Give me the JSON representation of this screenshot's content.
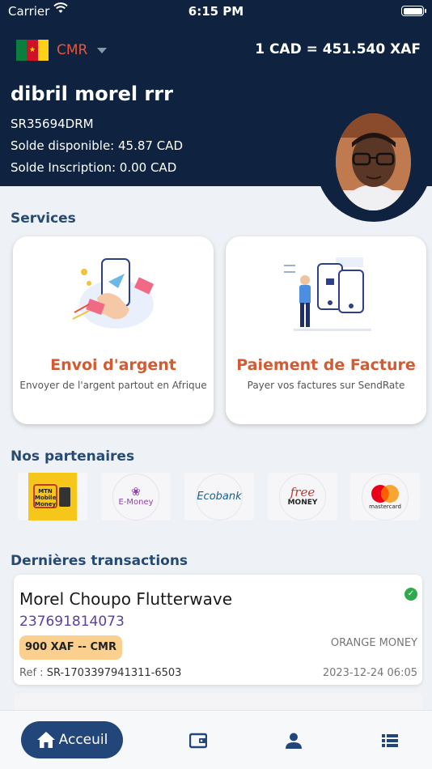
{
  "status_bar": {
    "carrier": "Carrier",
    "time": "6:15 PM"
  },
  "header": {
    "country_code": "CMR",
    "rate": "1 CAD = 451.540 XAF",
    "username": "dibril morel rrr",
    "account_id": "SR35694DRM",
    "solde_disponible": "Solde disponible: 45.87 CAD",
    "solde_inscription": "Solde Inscription: 0.00 CAD"
  },
  "services": {
    "title": "Services",
    "items": [
      {
        "title": "Envoi d'argent",
        "description": "Envoyer de l'argent partout en Afrique"
      },
      {
        "title": "Paiement de Facture",
        "description": "Payer vos factures sur SendRate"
      }
    ]
  },
  "partners": {
    "title": "Nos partenaires",
    "items": [
      {
        "name": "MTN Mobile Money",
        "line1": "MTN",
        "line2": "Mobile",
        "line3": "Money"
      },
      {
        "name": "E-Money",
        "label": "E-Money"
      },
      {
        "name": "Ecobank",
        "label": "Ecobank"
      },
      {
        "name": "Free Money",
        "line1": "free",
        "line2": "MONEY"
      },
      {
        "name": "Mastercard",
        "label": "mastercard"
      }
    ]
  },
  "transactions": {
    "title": "Dernières transactions",
    "items": [
      {
        "name": "Morel Choupo Flutterwave",
        "phone": "237691814073",
        "amount": "900  XAF -- CMR",
        "operator": "ORANGE MONEY",
        "ref_label": "Ref :",
        "ref": "SR-1703397941311-6503",
        "date": "2023-12-24 06:05"
      }
    ]
  },
  "nav": {
    "home_label": "Acceuil"
  },
  "colors": {
    "navy": "#0f2340",
    "accent": "#d35a32",
    "section": "#274a73",
    "nav_active": "#23467a"
  }
}
